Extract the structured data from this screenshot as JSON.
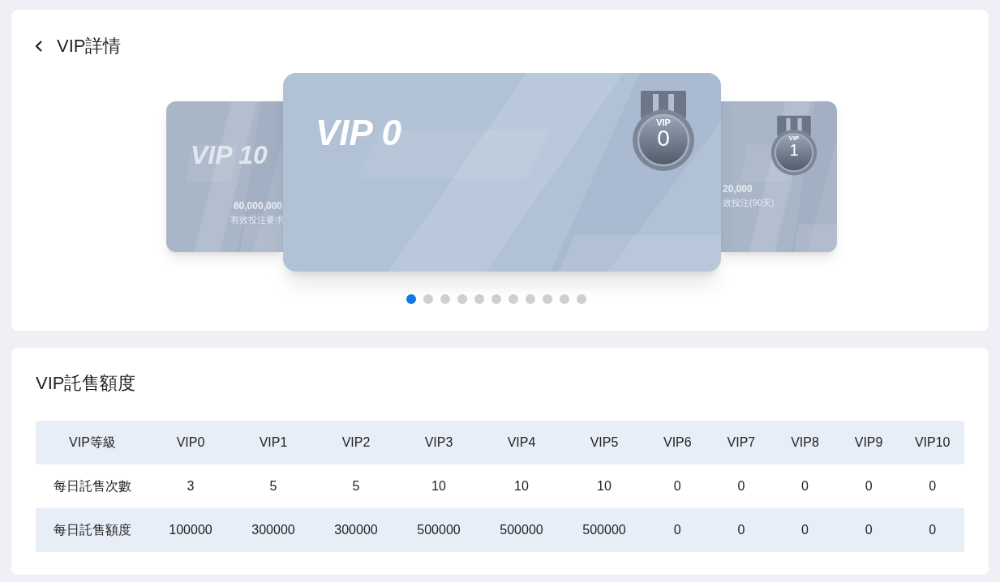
{
  "header": {
    "title": "VIP詳情"
  },
  "carousel": {
    "cards": [
      {
        "kind": "left",
        "title": "VIP 10",
        "amount": "60,000,000",
        "caption": "有效投注要求"
      },
      {
        "kind": "center",
        "title": "VIP 0",
        "medal_label": "VIP",
        "medal_level": "0"
      },
      {
        "kind": "right",
        "medal_label": "VIP",
        "medal_level": "1",
        "amount": "20,000",
        "caption": "效投注(90天)"
      }
    ],
    "dots": [
      {
        "selected": true
      },
      {
        "selected": false
      },
      {
        "selected": false
      },
      {
        "selected": false
      },
      {
        "selected": false
      },
      {
        "selected": false
      },
      {
        "selected": false
      },
      {
        "selected": false
      },
      {
        "selected": false
      },
      {
        "selected": false
      },
      {
        "selected": false
      }
    ]
  },
  "quota": {
    "title": "VIP託售額度",
    "table": {
      "columns": [
        "VIP等級",
        "VIP0",
        "VIP1",
        "VIP2",
        "VIP3",
        "VIP4",
        "VIP5",
        "VIP6",
        "VIP7",
        "VIP8",
        "VIP9",
        "VIP10"
      ],
      "rows": [
        [
          "每日託售次數",
          "3",
          "5",
          "5",
          "10",
          "10",
          "10",
          "0",
          "0",
          "0",
          "0",
          "0"
        ],
        [
          "每日託售額度",
          "100000",
          "300000",
          "300000",
          "500000",
          "500000",
          "500000",
          "0",
          "0",
          "0",
          "0",
          "0"
        ]
      ]
    }
  }
}
